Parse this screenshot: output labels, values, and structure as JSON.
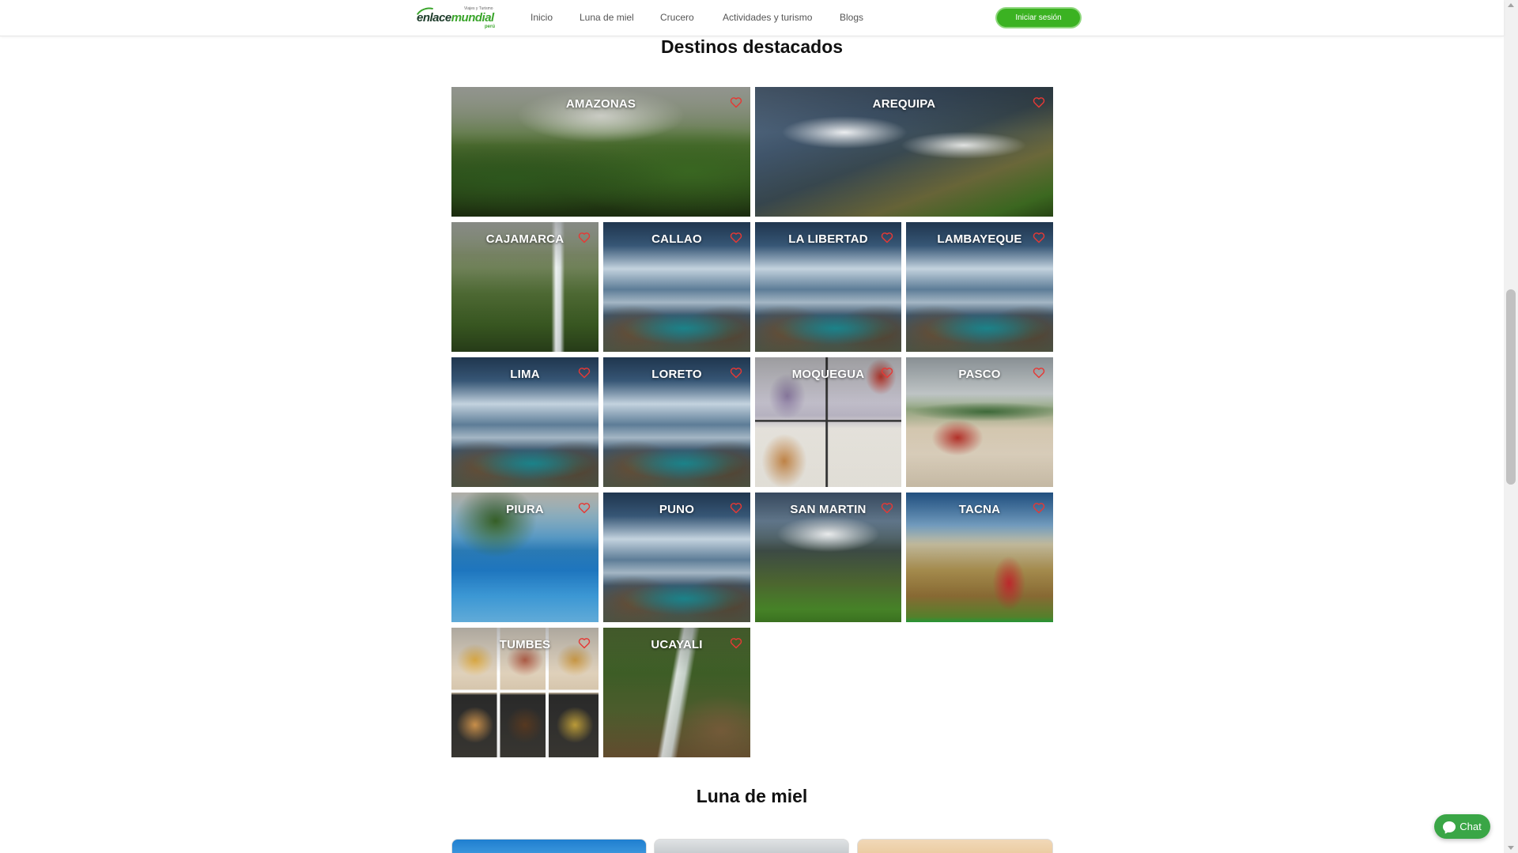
{
  "header": {
    "logo": {
      "main_pre": "enlace",
      "main_accent": "mundial",
      "tagline": "Viajes y Turismo",
      "sub": "perú"
    },
    "nav": [
      {
        "label": "Inicio"
      },
      {
        "label": "Luna de miel"
      },
      {
        "label": "Crucero"
      },
      {
        "label": "Actividades y turismo"
      },
      {
        "label": "Blogs"
      }
    ],
    "login_label": "Iniciar sesión"
  },
  "featured": {
    "title": "Destinos destacados",
    "destinations": [
      {
        "name": "AMAZONAS",
        "image": "jungle-valley"
      },
      {
        "name": "AREQUIPA",
        "image": "mountain-valley"
      },
      {
        "name": "CAJAMARCA",
        "image": "waterfall"
      },
      {
        "name": "CALLAO",
        "image": "glacier-lake"
      },
      {
        "name": "LA LIBERTAD",
        "image": "glacier-lake"
      },
      {
        "name": "LAMBAYEQUE",
        "image": "glacier-lake"
      },
      {
        "name": "LIMA",
        "image": "glacier-lake"
      },
      {
        "name": "LORETO",
        "image": "glacier-lake"
      },
      {
        "name": "MOQUEGUA",
        "image": "comic"
      },
      {
        "name": "PASCO",
        "image": "desert-buggy"
      },
      {
        "name": "PIURA",
        "image": "infinity-pool"
      },
      {
        "name": "PUNO",
        "image": "glacier-lake"
      },
      {
        "name": "SAN MARTIN",
        "image": "green-valley"
      },
      {
        "name": "TACNA",
        "image": "traveler-mountains"
      },
      {
        "name": "TUMBES",
        "image": "food-collage"
      },
      {
        "name": "UCAYALI",
        "image": "jungle-waterfall"
      }
    ]
  },
  "honeymoon": {
    "title": "Luna de miel"
  },
  "chat": {
    "label": "Chat"
  },
  "colors": {
    "brand_green": "#3bb222",
    "heart_red": "#e53935",
    "chat_green": "#3aa646"
  }
}
